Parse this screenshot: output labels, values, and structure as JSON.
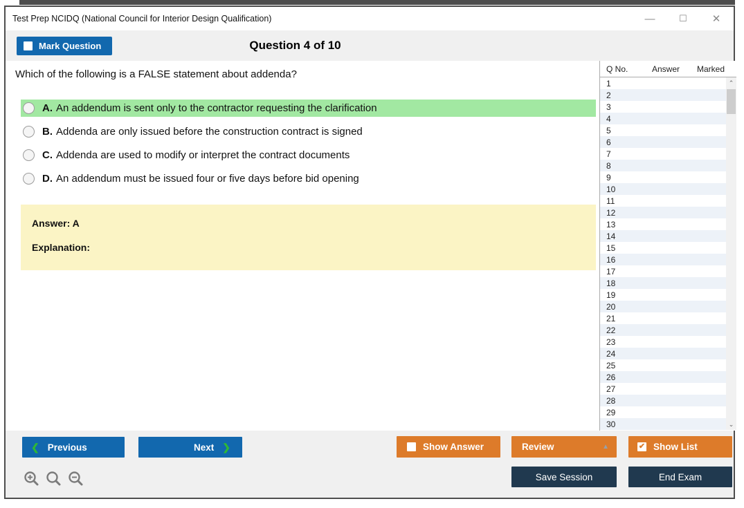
{
  "window": {
    "title": "Test Prep NCIDQ (National Council for Interior Design Qualification)",
    "controls": {
      "minimize": "—",
      "maximize": "☐",
      "close": "✕"
    }
  },
  "header": {
    "mark_question_label": "Mark Question",
    "mark_question_checked": false,
    "question_counter": "Question 4 of 10"
  },
  "question": {
    "text": "Which of the following is a FALSE statement about addenda?",
    "options": [
      {
        "letter": "A.",
        "text": "An addendum is sent only to the contractor requesting the clarification",
        "highlighted": true,
        "selected": false
      },
      {
        "letter": "B.",
        "text": "Addenda are only issued before the construction contract is signed",
        "highlighted": false,
        "selected": false
      },
      {
        "letter": "C.",
        "text": "Addenda are used to modify or interpret the contract documents",
        "highlighted": false,
        "selected": false
      },
      {
        "letter": "D.",
        "text": "An addendum must be issued four or five days before bid opening",
        "highlighted": false,
        "selected": false
      }
    ],
    "answer_label": "Answer: A",
    "explanation_label": "Explanation:"
  },
  "question_list": {
    "columns": [
      "Q No.",
      "Answer",
      "Marked"
    ],
    "rows": [
      {
        "q": "1",
        "answer": "",
        "marked": ""
      },
      {
        "q": "2",
        "answer": "",
        "marked": ""
      },
      {
        "q": "3",
        "answer": "",
        "marked": ""
      },
      {
        "q": "4",
        "answer": "",
        "marked": ""
      },
      {
        "q": "5",
        "answer": "",
        "marked": ""
      },
      {
        "q": "6",
        "answer": "",
        "marked": ""
      },
      {
        "q": "7",
        "answer": "",
        "marked": ""
      },
      {
        "q": "8",
        "answer": "",
        "marked": ""
      },
      {
        "q": "9",
        "answer": "",
        "marked": ""
      },
      {
        "q": "10",
        "answer": "",
        "marked": ""
      },
      {
        "q": "11",
        "answer": "",
        "marked": ""
      },
      {
        "q": "12",
        "answer": "",
        "marked": ""
      },
      {
        "q": "13",
        "answer": "",
        "marked": ""
      },
      {
        "q": "14",
        "answer": "",
        "marked": ""
      },
      {
        "q": "15",
        "answer": "",
        "marked": ""
      },
      {
        "q": "16",
        "answer": "",
        "marked": ""
      },
      {
        "q": "17",
        "answer": "",
        "marked": ""
      },
      {
        "q": "18",
        "answer": "",
        "marked": ""
      },
      {
        "q": "19",
        "answer": "",
        "marked": ""
      },
      {
        "q": "20",
        "answer": "",
        "marked": ""
      },
      {
        "q": "21",
        "answer": "",
        "marked": ""
      },
      {
        "q": "22",
        "answer": "",
        "marked": ""
      },
      {
        "q": "23",
        "answer": "",
        "marked": ""
      },
      {
        "q": "24",
        "answer": "",
        "marked": ""
      },
      {
        "q": "25",
        "answer": "",
        "marked": ""
      },
      {
        "q": "26",
        "answer": "",
        "marked": ""
      },
      {
        "q": "27",
        "answer": "",
        "marked": ""
      },
      {
        "q": "28",
        "answer": "",
        "marked": ""
      },
      {
        "q": "29",
        "answer": "",
        "marked": ""
      },
      {
        "q": "30",
        "answer": "",
        "marked": ""
      }
    ],
    "scrollbar": {
      "up_glyph": "⌃",
      "down_glyph": "⌄"
    }
  },
  "footer": {
    "previous_label": "Previous",
    "next_label": "Next",
    "prev_chevron": "❮",
    "next_chevron": "❯",
    "show_answer_label": "Show Answer",
    "show_answer_checked": false,
    "review_label": "Review",
    "review_arrow": "▲",
    "show_list_label": "Show List",
    "show_list_checked": true,
    "show_list_check_glyph": "✔",
    "save_session_label": "Save Session",
    "end_exam_label": "End Exam",
    "zoom_tools": [
      "zoom-in",
      "zoom",
      "zoom-out"
    ]
  },
  "colors": {
    "accent_blue": "#1268ae",
    "accent_orange": "#dd7b2a",
    "accent_navy": "#20394f",
    "highlight_green": "#a2e8a2",
    "answer_yellow": "#fbf4c5",
    "bar_gray": "#f0f0f0",
    "alt_row_blue": "#edf2f8",
    "chevron_green": "#2eb835"
  }
}
